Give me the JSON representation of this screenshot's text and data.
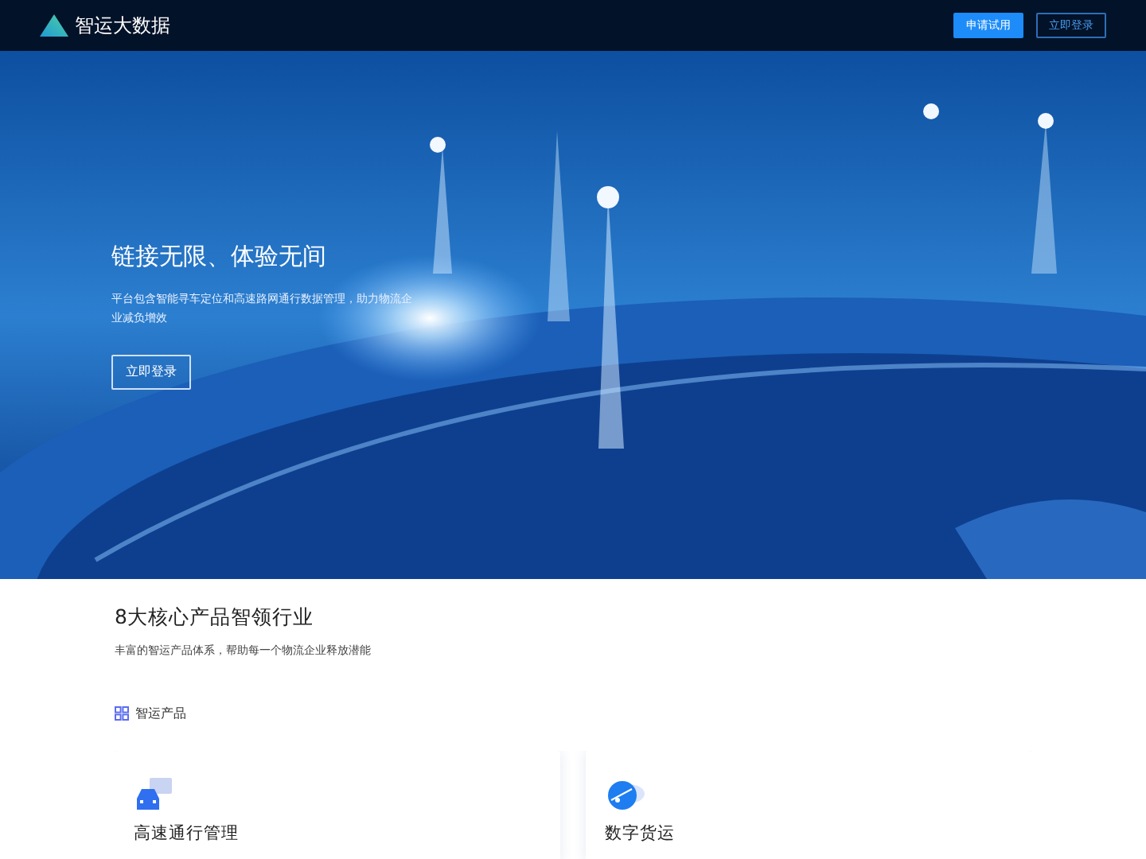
{
  "navbar": {
    "brand": "智运大数据",
    "buttons": [
      {
        "label": "申请试用",
        "kind": "primary"
      },
      {
        "label": "立即登录",
        "kind": "outline"
      }
    ]
  },
  "hero": {
    "title": "链接无限、体验无间",
    "text": "平台包含智能寻车定位和高速路网通行数据管理，助力物流企业减负增效",
    "button": "立即登录"
  },
  "section": {
    "title": "8大核心产品智领行业",
    "subtitle": "丰富的智运产品体系，帮助每一个物流企业释放潜能",
    "tab": "智运产品"
  },
  "products": [
    {
      "kind": "car",
      "title": "高速通行管理"
    },
    {
      "kind": "globe",
      "title": "数字货运"
    }
  ]
}
